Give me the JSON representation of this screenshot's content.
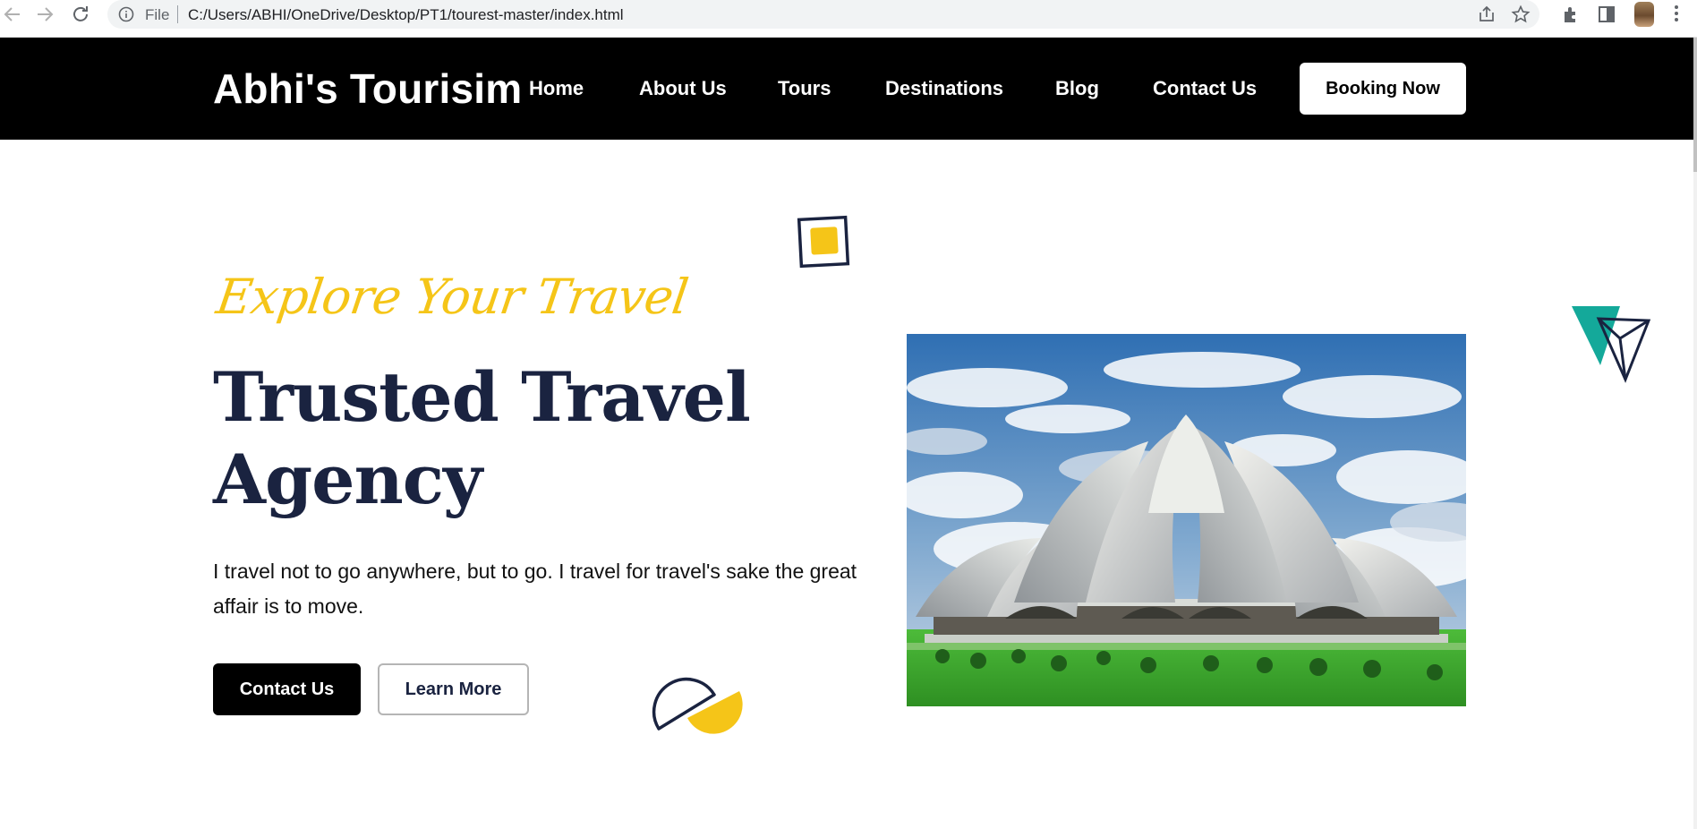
{
  "browser": {
    "file_label": "File",
    "url": "C:/Users/ABHI/OneDrive/Desktop/PT1/tourest-master/index.html",
    "icons": [
      "back-arrow-icon",
      "forward-arrow-icon",
      "reload-icon",
      "info-icon",
      "share-icon",
      "star-icon",
      "puzzle-icon",
      "side-panel-icon",
      "kebab-menu-icon"
    ]
  },
  "header": {
    "logo": "Abhi's Tourisim",
    "nav": [
      "Home",
      "About Us",
      "Tours",
      "Destinations",
      "Blog",
      "Contact Us"
    ],
    "cta": "Booking Now"
  },
  "hero": {
    "tagline": "Explore Your Travel",
    "title": "Trusted Travel Agency",
    "text": "I travel not to go anywhere, but to go. I travel for travel's sake the great affair is to move.",
    "primary_button": "Contact Us",
    "secondary_button": "Learn More"
  },
  "colors": {
    "header_bg": "#000000",
    "accent_yellow": "#f5c518",
    "heading_navy": "#1a2340",
    "teal": "#14a99a"
  }
}
